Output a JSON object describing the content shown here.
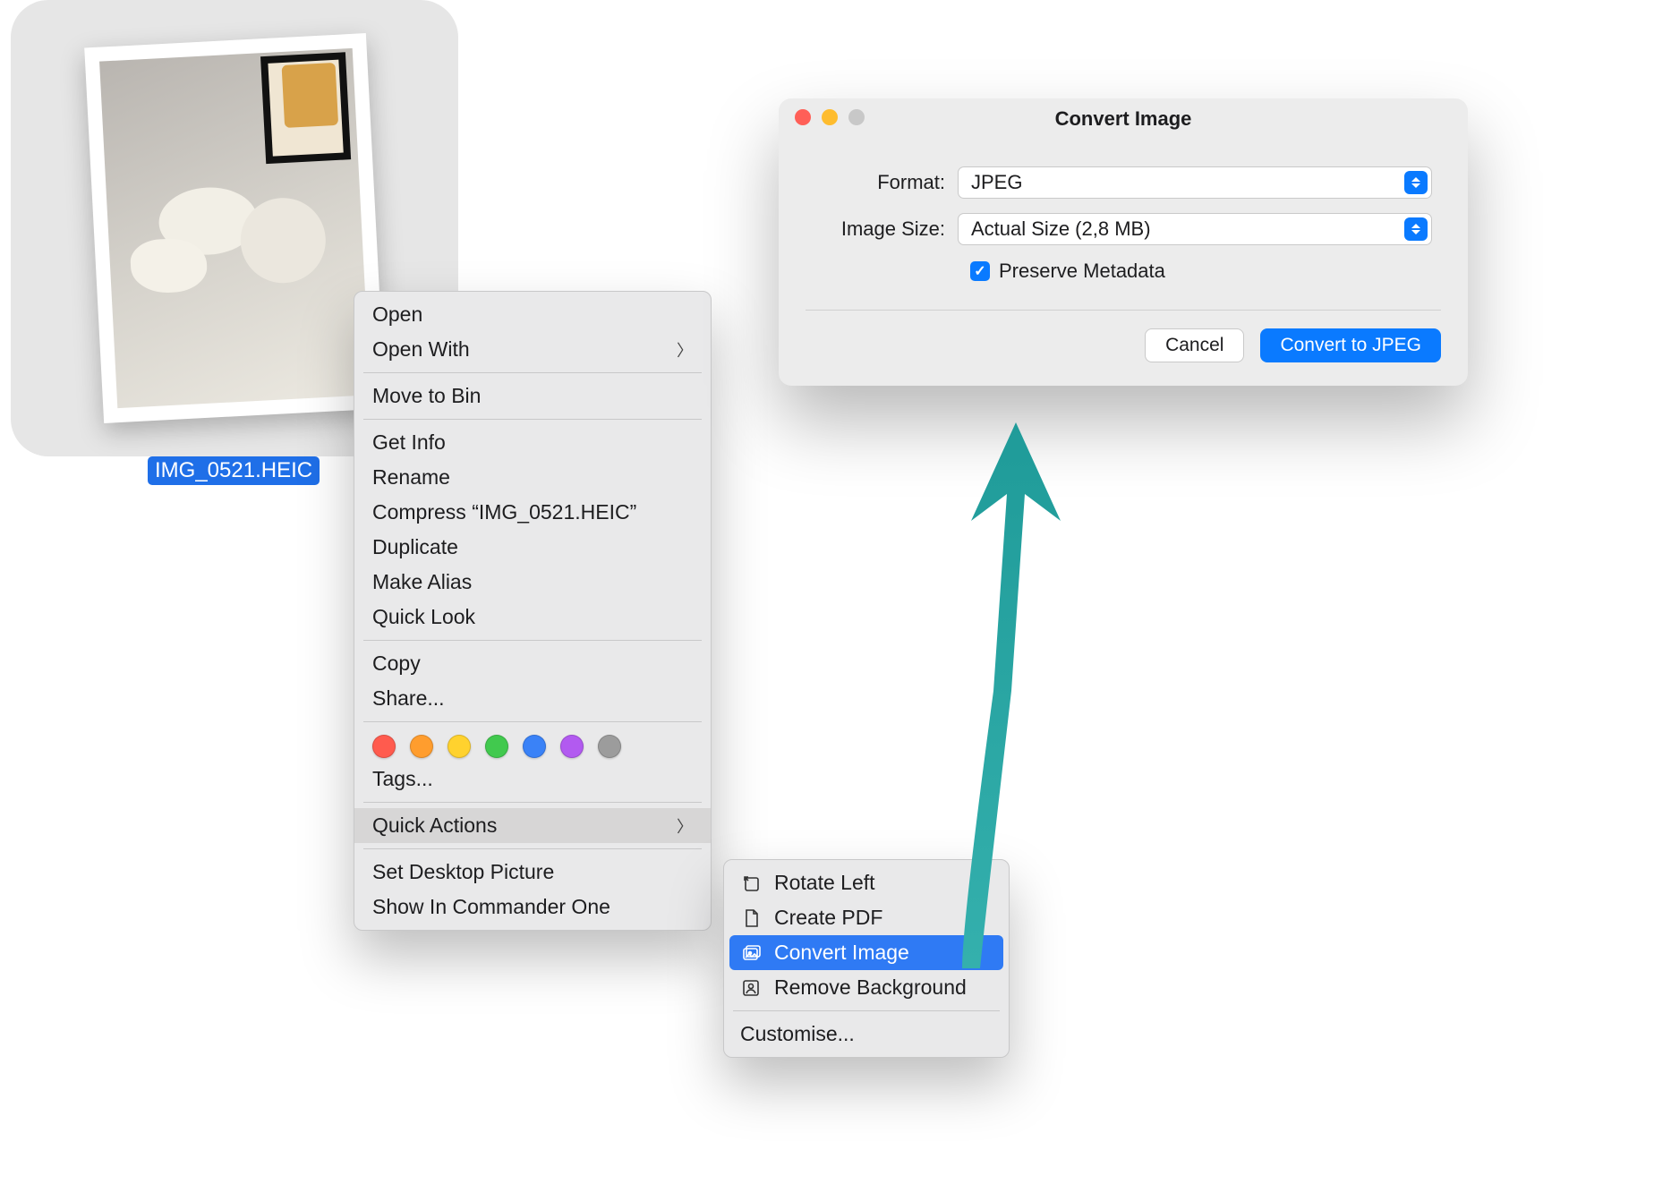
{
  "file": {
    "label": "IMG_0521.HEIC"
  },
  "context_menu": {
    "open": "Open",
    "open_with": "Open With",
    "move_to_bin": "Move to Bin",
    "get_info": "Get Info",
    "rename": "Rename",
    "compress": "Compress “IMG_0521.HEIC”",
    "duplicate": "Duplicate",
    "make_alias": "Make Alias",
    "quick_look": "Quick Look",
    "copy": "Copy",
    "share": "Share...",
    "tags": "Tags...",
    "quick_actions": "Quick Actions",
    "set_desktop": "Set Desktop Picture",
    "show_commander": "Show In Commander One",
    "tag_colors": [
      "#ff5b4e",
      "#ff9d2e",
      "#ffd22e",
      "#41c94e",
      "#3a82f7",
      "#b25af0",
      "#9c9c9c"
    ]
  },
  "submenu": {
    "rotate_left": "Rotate Left",
    "create_pdf": "Create PDF",
    "convert_image": "Convert Image",
    "remove_bg": "Remove Background",
    "customise": "Customise..."
  },
  "dialog": {
    "title": "Convert Image",
    "format_label": "Format:",
    "format_value": "JPEG",
    "size_label": "Image Size:",
    "size_value": "Actual Size (2,8 MB)",
    "preserve_metadata": "Preserve Metadata",
    "cancel": "Cancel",
    "convert": "Convert to JPEG"
  }
}
